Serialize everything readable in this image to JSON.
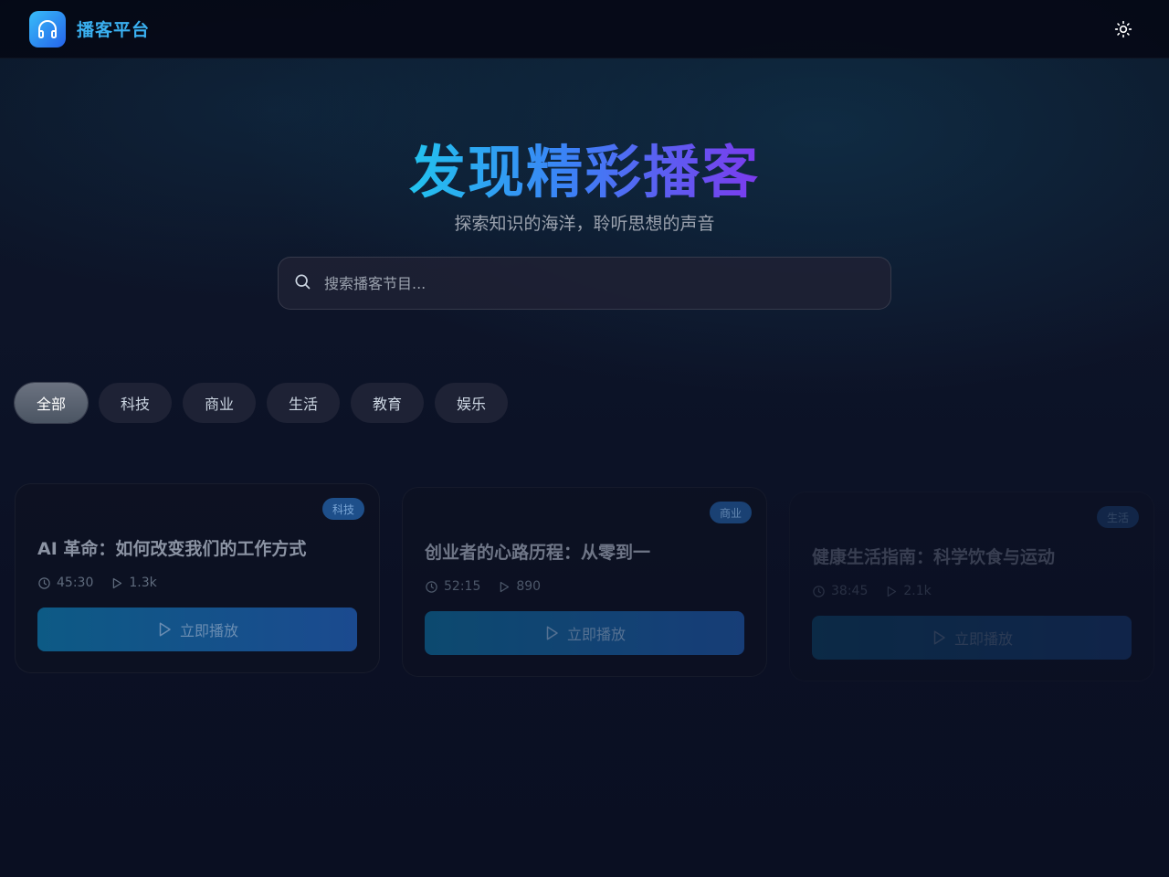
{
  "header": {
    "brand": "播客平台",
    "logo_icon": "headphones-icon",
    "theme_icon": "sun-icon"
  },
  "hero": {
    "title": "发现精彩播客",
    "subtitle": "探索知识的海洋，聆听思想的声音"
  },
  "search": {
    "placeholder": "搜索播客节目...",
    "icon": "search-icon"
  },
  "categories": [
    {
      "label": "全部",
      "active": true
    },
    {
      "label": "科技",
      "active": false
    },
    {
      "label": "商业",
      "active": false
    },
    {
      "label": "生活",
      "active": false
    },
    {
      "label": "教育",
      "active": false
    },
    {
      "label": "娱乐",
      "active": false
    }
  ],
  "cards": [
    {
      "badge": "科技",
      "title": "AI 革命：如何改变我们的工作方式",
      "duration": "45:30",
      "plays": "1.3k",
      "play_label": "立即播放"
    },
    {
      "badge": "商业",
      "title": "创业者的心路历程：从零到一",
      "duration": "52:15",
      "plays": "890",
      "play_label": "立即播放"
    },
    {
      "badge": "生活",
      "title": "健康生活指南：科学饮食与运动",
      "duration": "38:45",
      "plays": "2.1k",
      "play_label": "立即播放"
    }
  ],
  "colors": {
    "accent_cyan": "#22c3ee",
    "accent_blue": "#3b82f6",
    "accent_purple": "#7c3aed",
    "background": "#0b1024"
  }
}
